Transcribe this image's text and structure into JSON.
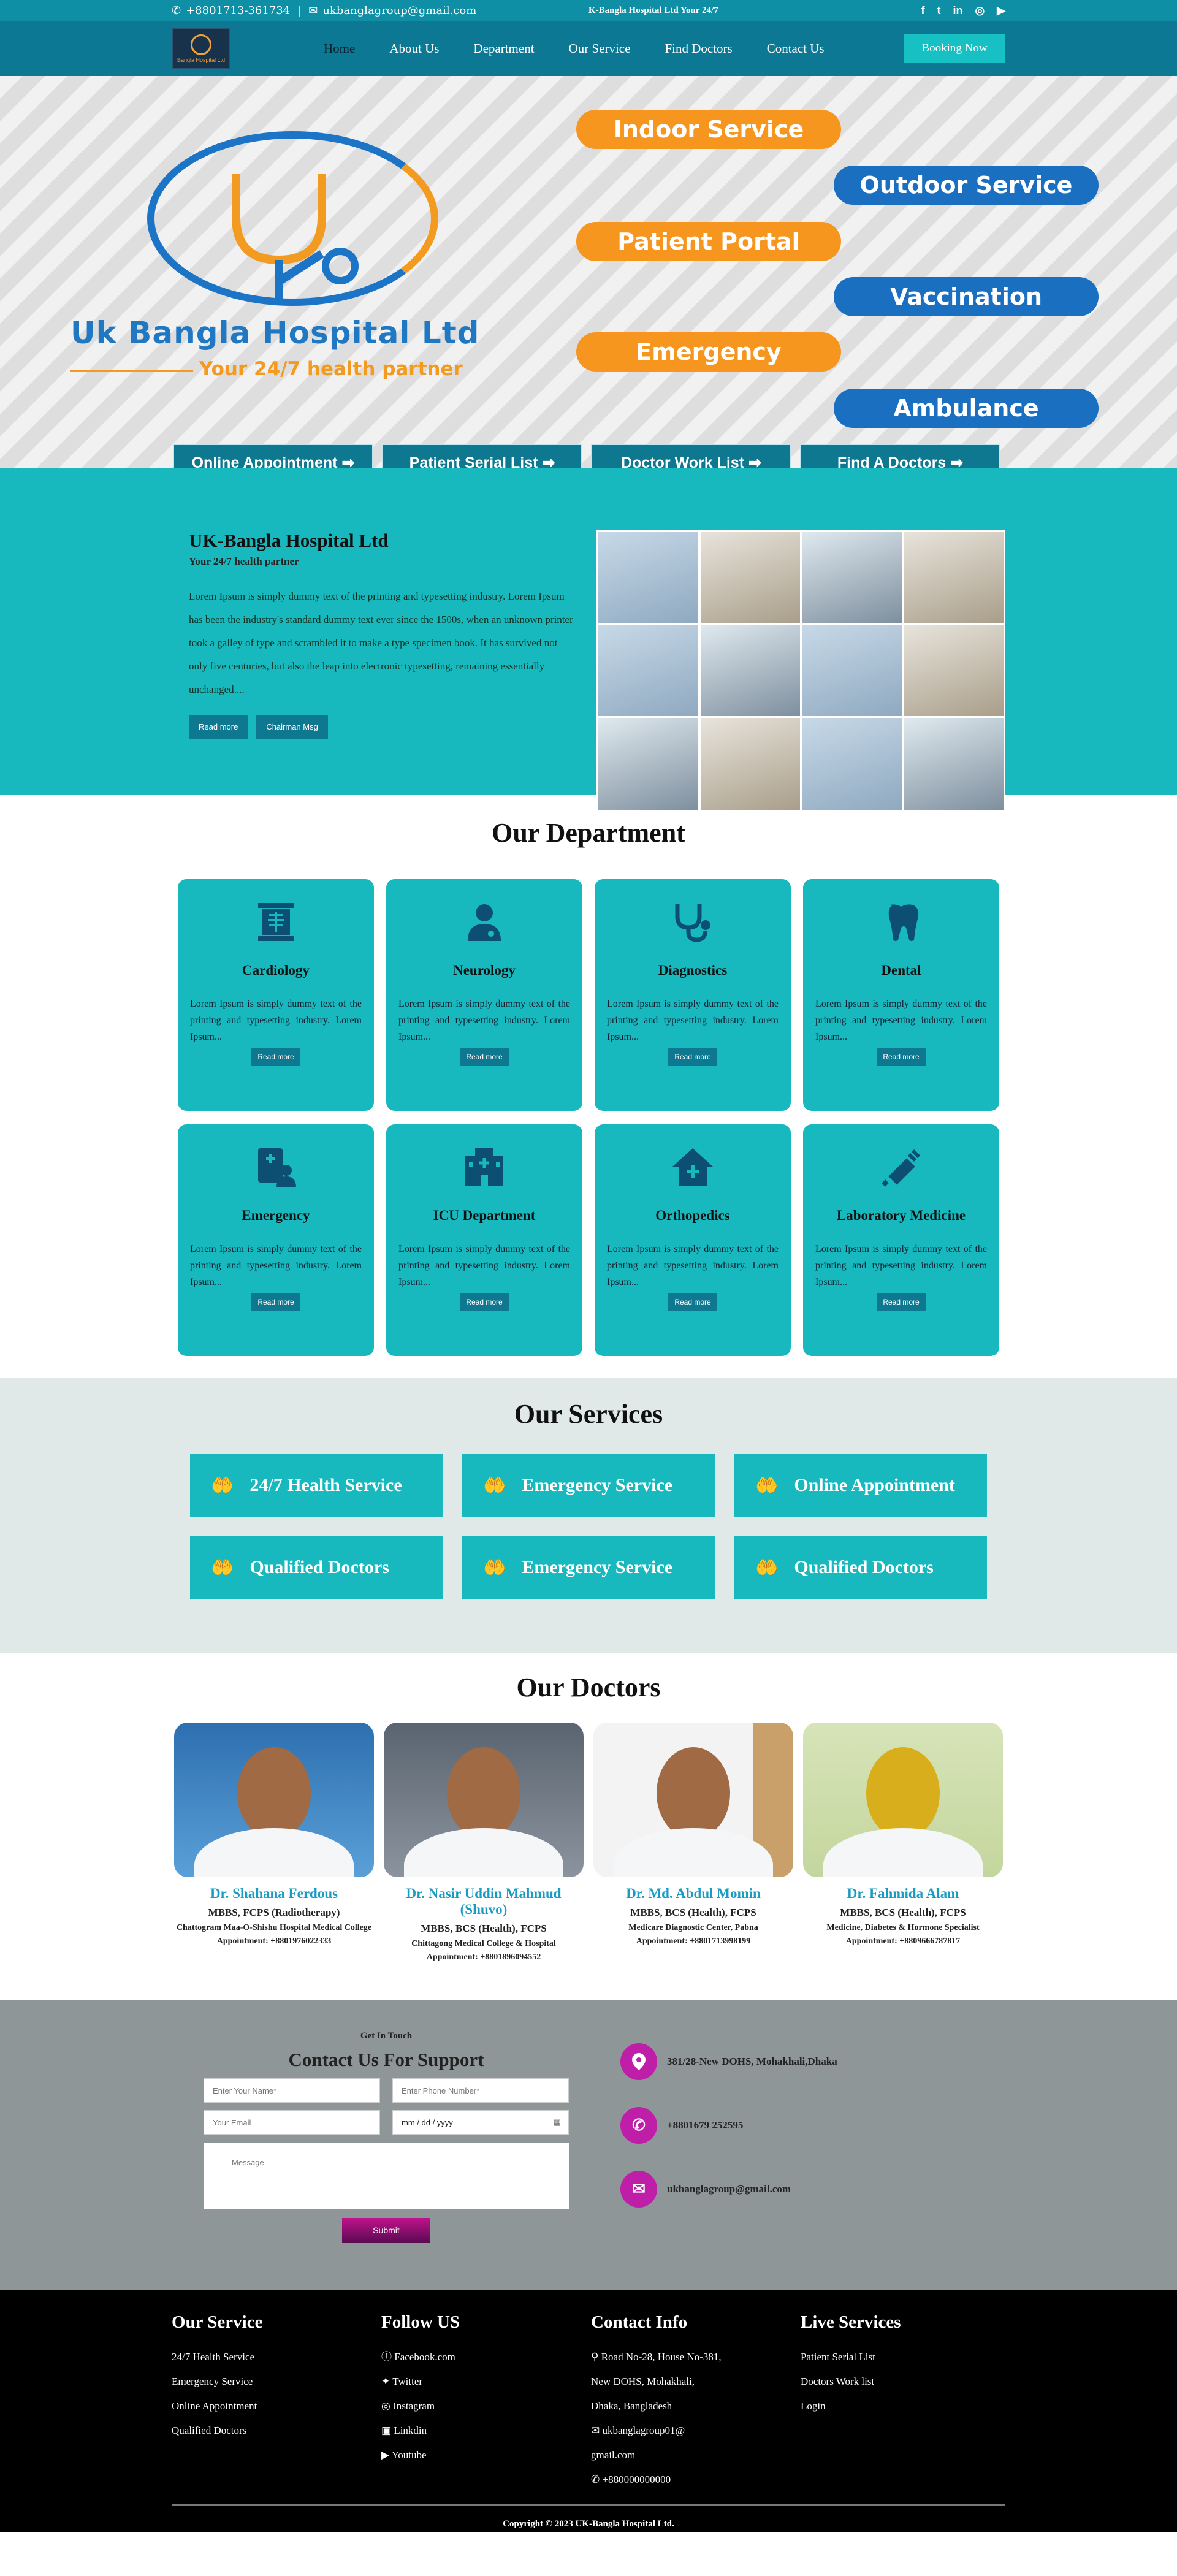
{
  "topbar": {
    "phone": "+8801713-361734",
    "email": "ukbanglagroup@gmail.com",
    "tagline": "K-Bangla Hospital Ltd Your 24/7"
  },
  "navbar": {
    "logo_text": "Bangla Hospital Ltd",
    "items": [
      "Home",
      "About Us",
      "Department",
      "Our Service",
      "Find Doctors",
      "Contact Us"
    ],
    "booking": "Booking Now"
  },
  "hero": {
    "name": "Uk Bangla Hospital Ltd",
    "subtitle": "Your 24/7 health partner",
    "pills": [
      "Indoor Service",
      "Outdoor Service",
      "Patient Portal",
      "Vaccination",
      "Emergency",
      "Ambulance"
    ],
    "quick_links": [
      "Online Appointment ➡",
      "Patient Serial List ➡",
      "Doctor Work List ➡",
      "Find A Doctors ➡"
    ]
  },
  "about": {
    "title": "UK-Bangla Hospital Ltd",
    "subtitle": "Your 24/7 health partner",
    "body": "Lorem Ipsum is simply dummy text of the printing and typesetting industry. Lorem Ipsum has been the industry's standard dummy text ever since the 1500s, when an unknown printer took a galley of type and scrambled it to make a type specimen book. It has survived not only five centuries, but also the leap into electronic typesetting, remaining essentially unchanged....",
    "btn_read": "Read more",
    "btn_chairman": "Chairman Msg"
  },
  "department": {
    "title": "Our Department",
    "read_more": "Read more",
    "items": [
      {
        "name": "Cardiology",
        "icon": "xray-icon",
        "text": "Lorem Ipsum is simply dummy text of the printing and typesetting industry. Lorem Ipsum..."
      },
      {
        "name": "Neurology",
        "icon": "doctor-icon",
        "text": "Lorem Ipsum is simply dummy text of the printing and typesetting industry. Lorem Ipsum..."
      },
      {
        "name": "Diagnostics",
        "icon": "stethoscope-icon",
        "text": "Lorem Ipsum is simply dummy text of the printing and typesetting industry. Lorem Ipsum..."
      },
      {
        "name": "Dental",
        "icon": "tooth-icon",
        "text": "Lorem Ipsum is simply dummy text of the printing and typesetting industry. Lorem Ipsum..."
      },
      {
        "name": "Emergency",
        "icon": "patient-record-icon",
        "text": "Lorem Ipsum is simply dummy text of the printing and typesetting industry. Lorem Ipsum..."
      },
      {
        "name": "ICU Department",
        "icon": "hospital-building-icon",
        "text": "Lorem Ipsum is simply dummy text of the printing and typesetting industry. Lorem Ipsum..."
      },
      {
        "name": "Orthopedics",
        "icon": "house-medical-icon",
        "text": "Lorem Ipsum is simply dummy text of the printing and typesetting industry. Lorem Ipsum..."
      },
      {
        "name": "Laboratory Medicine",
        "icon": "syringe-icon",
        "text": "Lorem Ipsum is simply dummy text of the printing and typesetting industry. Lorem Ipsum..."
      }
    ]
  },
  "services": {
    "title": "Our Services",
    "items": [
      "24/7 Health Service",
      "Emergency Service",
      "Online Appointment",
      "Qualified Doctors",
      "Emergency Service",
      "Qualified Doctors"
    ]
  },
  "doctors": {
    "title": "Our Doctors",
    "items": [
      {
        "name": "Dr. Shahana Ferdous",
        "degree": "MBBS, FCPS (Radiotherapy)",
        "inst": "Chattogram Maa-O-Shishu Hospital Medical College",
        "appt": "Appointment: +8801976022333"
      },
      {
        "name": "Dr. Nasir Uddin Mahmud (Shuvo)",
        "degree": "MBBS, BCS (Health), FCPS",
        "inst": "Chittagong Medical College & Hospital",
        "appt": "Appointment: +8801896094552"
      },
      {
        "name": "Dr. Md. Abdul Momin",
        "degree": "MBBS, BCS (Health), FCPS",
        "inst": "Medicare Diagnostic Center, Pabna",
        "appt": "Appointment: +8801713998199"
      },
      {
        "name": "Dr. Fahmida Alam",
        "degree": "MBBS, BCS (Health), FCPS",
        "inst": "Medicine, Diabetes & Hormone Specialist",
        "appt": "Appointment: +8809666787817"
      }
    ]
  },
  "contact": {
    "get_in_touch": "Get In Touch",
    "title": "Contact Us For Support",
    "name_ph": "Enter Your Name*",
    "phone_ph": "Enter Phone Number*",
    "email_ph": "Your Email",
    "date_ph": "mm / dd / yyyy",
    "message_ph": "Message",
    "submit": "Submit",
    "address": "381/28-New DOHS, Mohakhali,Dhaka",
    "phone": "+8801679 252595",
    "email": "ukbanglagroup@gmail.com"
  },
  "footer": {
    "col1": {
      "title": "Our Service",
      "items": [
        "24/7 Health Service",
        "Emergency Service",
        "Online Appointment",
        "Qualified Doctors"
      ]
    },
    "col2": {
      "title": "Follow US",
      "items": [
        "Facebook.com",
        "Twitter",
        "Instagram",
        "Linkdin",
        "Youtube"
      ]
    },
    "col3": {
      "title": "Contact Info",
      "items": [
        "Road No-28, House No-381,",
        "New DOHS, Mohakhali,",
        "Dhaka, Bangladesh",
        "ukbanglagroup01@",
        "gmail.com",
        "+880000000000"
      ]
    },
    "col4": {
      "title": "Live Services",
      "items": [
        "Patient Serial List",
        "Doctors Work list",
        "Login"
      ]
    },
    "copyright": "Copyright © 2023 UK-Bangla Hospital Ltd."
  }
}
